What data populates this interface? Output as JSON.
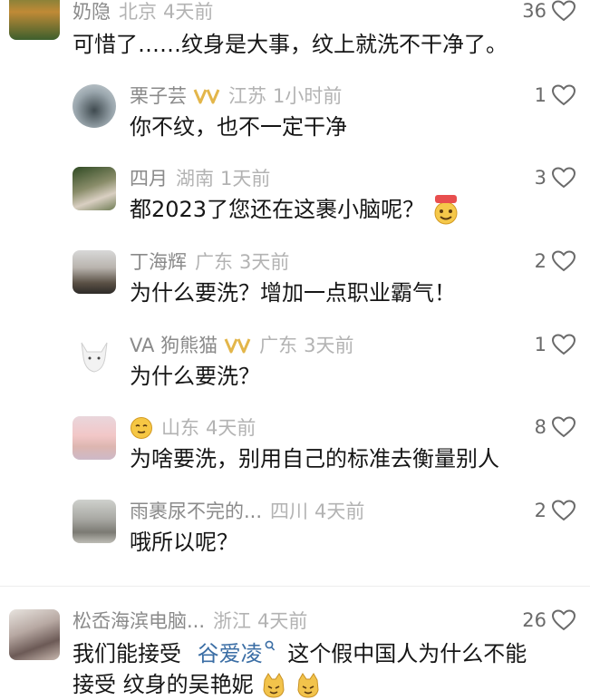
{
  "top_comment": {
    "username": "奶隐",
    "location": "北京",
    "time": "4天前",
    "text": "可惜了……纹身是大事，纹上就洗不干净了。",
    "likes": "36"
  },
  "replies": [
    {
      "username": "栗子芸",
      "has_badge": true,
      "location": "江苏",
      "time": "1小时前",
      "text": "你不纹，也不一定干净",
      "likes": "1"
    },
    {
      "username": "四月",
      "has_badge": false,
      "location": "湖南",
      "time": "1天前",
      "text": "都2023了您还在这裹小脑呢？",
      "likes": "3"
    },
    {
      "username": "丁海辉",
      "has_badge": false,
      "location": "广东",
      "time": "3天前",
      "text": "为什么要洗？增加一点职业霸气！",
      "likes": "2"
    },
    {
      "username": "VA 狗熊猫",
      "has_badge": true,
      "location": "广东",
      "time": "3天前",
      "text": "为什么要洗？",
      "likes": "1"
    },
    {
      "username": "",
      "has_badge": false,
      "location": "山东",
      "time": "4天前",
      "text": "为啥要洗，别用自己的标准去衡量别人",
      "likes": "8"
    },
    {
      "username": "雨裹尿不完的...",
      "has_badge": false,
      "location": "四川",
      "time": "4天前",
      "text": "哦所以呢？",
      "likes": "2"
    }
  ],
  "bottom_comment": {
    "username": "松岙海滨电脑...",
    "location": "浙江",
    "time": "4天前",
    "text_before": "我们能接受",
    "search_tag": "谷爱凌",
    "text_after": "这个假中国人为什么不能",
    "line2": "接受 纹身的吴艳妮",
    "likes": "26"
  },
  "colors": {
    "username": "#8a8a8a",
    "location_time": "#b3b3b3",
    "body_text": "#161616",
    "badge": "#e3b64a",
    "link": "#3b6ea5"
  }
}
